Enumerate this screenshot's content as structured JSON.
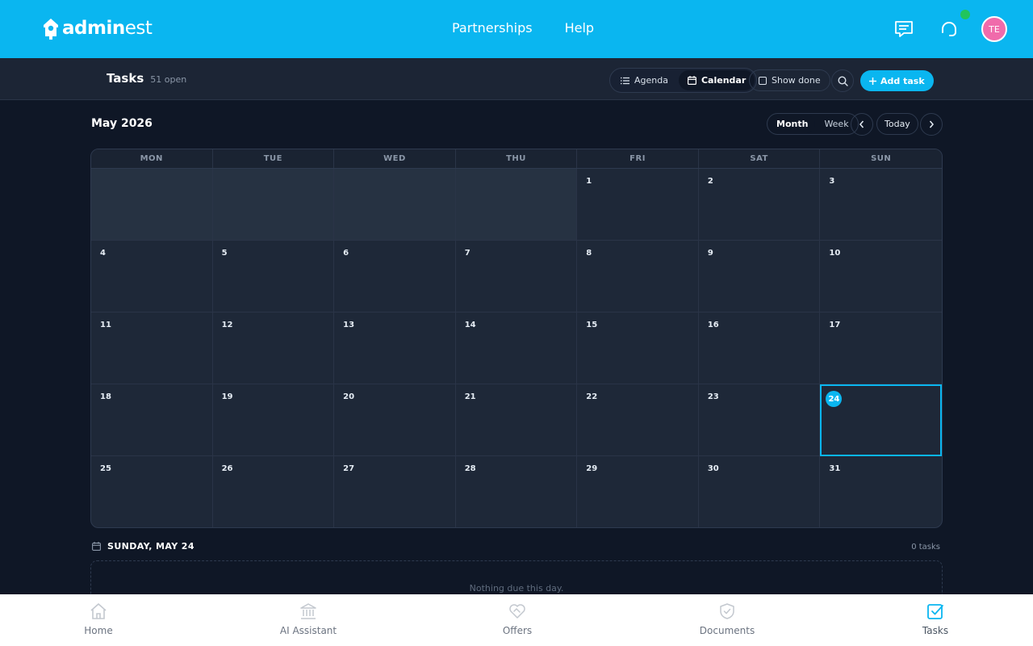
{
  "brand": {
    "name_bold": "admin",
    "name_light": "est"
  },
  "topnav": {
    "links": [
      "Partnerships",
      "Help"
    ]
  },
  "user": {
    "initials": "TE"
  },
  "subheader": {
    "title": "Tasks",
    "open_count": "51 open",
    "view_agenda": "Agenda",
    "view_calendar": "Calendar",
    "show_done": "Show done",
    "add_task": "Add task"
  },
  "calendar": {
    "month_label": "May 2026",
    "mode_month": "Month",
    "mode_week": "Week",
    "today_label": "Today",
    "weekdays": [
      "MON",
      "TUE",
      "WED",
      "THU",
      "FRI",
      "SAT",
      "SUN"
    ],
    "leading_blanks": 4,
    "days_in_month": 31,
    "today": 24
  },
  "day_detail": {
    "heading": "SUNDAY, MAY 24",
    "task_count": "0 tasks",
    "empty_text": "Nothing due this day."
  },
  "bottomnav": {
    "items": [
      {
        "label": "Home",
        "icon": "home-icon"
      },
      {
        "label": "AI Assistant",
        "icon": "bank-icon"
      },
      {
        "label": "Offers",
        "icon": "heart-handshake-icon"
      },
      {
        "label": "Documents",
        "icon": "shield-check-icon"
      },
      {
        "label": "Tasks",
        "icon": "checkbox-icon"
      }
    ],
    "active": "Tasks"
  },
  "colors": {
    "brand": "#0ab6f0",
    "background": "#0f1726",
    "online": "#21c45d",
    "avatar": "#f06bab"
  }
}
